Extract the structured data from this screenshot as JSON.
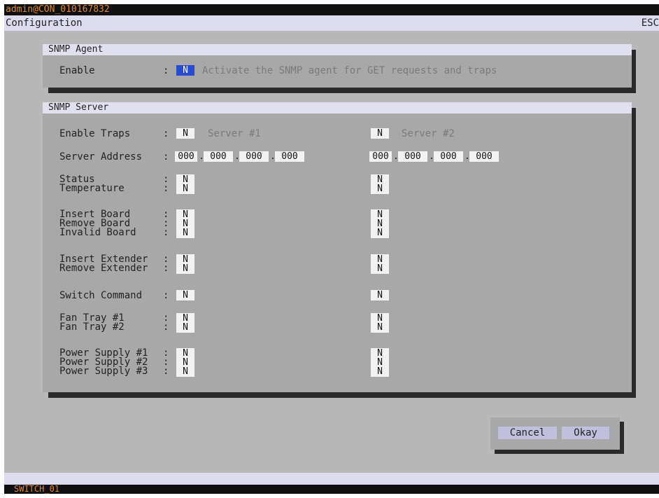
{
  "top_bar": {
    "user": "admin@CON_010167832"
  },
  "title_bar": {
    "title": "Configuration",
    "esc_label": "ESC"
  },
  "snmp_agent": {
    "header": "SNMP Agent",
    "enable_label": "Enable",
    "enable_value": "N",
    "enable_hint": "Activate the SNMP agent for GET requests and traps"
  },
  "snmp_server": {
    "header": "SNMP Server",
    "enable_traps_label": "Enable Traps",
    "server1": {
      "enable_traps": "N",
      "name": "Server #1",
      "address": [
        "000",
        "000",
        "000",
        "000"
      ],
      "status": "N",
      "temperature": "N",
      "insert_board": "N",
      "remove_board": "N",
      "invalid_board": "N",
      "insert_extender": "N",
      "remove_extender": "N",
      "switch_command": "N",
      "fan_tray_1": "N",
      "fan_tray_2": "N",
      "power_supply_1": "N",
      "power_supply_2": "N",
      "power_supply_3": "N"
    },
    "server2": {
      "enable_traps": "N",
      "name": "Server #2",
      "address": [
        "000",
        "000",
        "000",
        "000"
      ],
      "status": "N",
      "temperature": "N",
      "insert_board": "N",
      "remove_board": "N",
      "invalid_board": "N",
      "insert_extender": "N",
      "remove_extender": "N",
      "switch_command": "N",
      "fan_tray_1": "N",
      "fan_tray_2": "N",
      "power_supply_1": "N",
      "power_supply_2": "N",
      "power_supply_3": "N"
    },
    "labels": {
      "server_address": "Server Address",
      "status": "Status",
      "temperature": "Temperature",
      "insert_board": "Insert Board",
      "remove_board": "Remove Board",
      "invalid_board": "Invalid Board",
      "insert_extender": "Insert Extender",
      "remove_extender": "Remove Extender",
      "switch_command": "Switch Command",
      "fan_tray_1": "Fan Tray #1",
      "fan_tray_2": "Fan Tray #2",
      "power_supply_1": "Power Supply #1",
      "power_supply_2": "Power Supply #2",
      "power_supply_3": "Power Supply #3"
    },
    "colon": ":"
  },
  "buttons": {
    "cancel": "Cancel",
    "okay": "Okay"
  },
  "bottom_bar": {
    "device": "SWITCH_01"
  },
  "colors": {
    "background": "#b8b8b8",
    "panel": "#a8a8a8",
    "header_bar": "#e0e0ee",
    "status_bar_text": "#e08a2a",
    "selected_field": "#2a4ad0"
  }
}
